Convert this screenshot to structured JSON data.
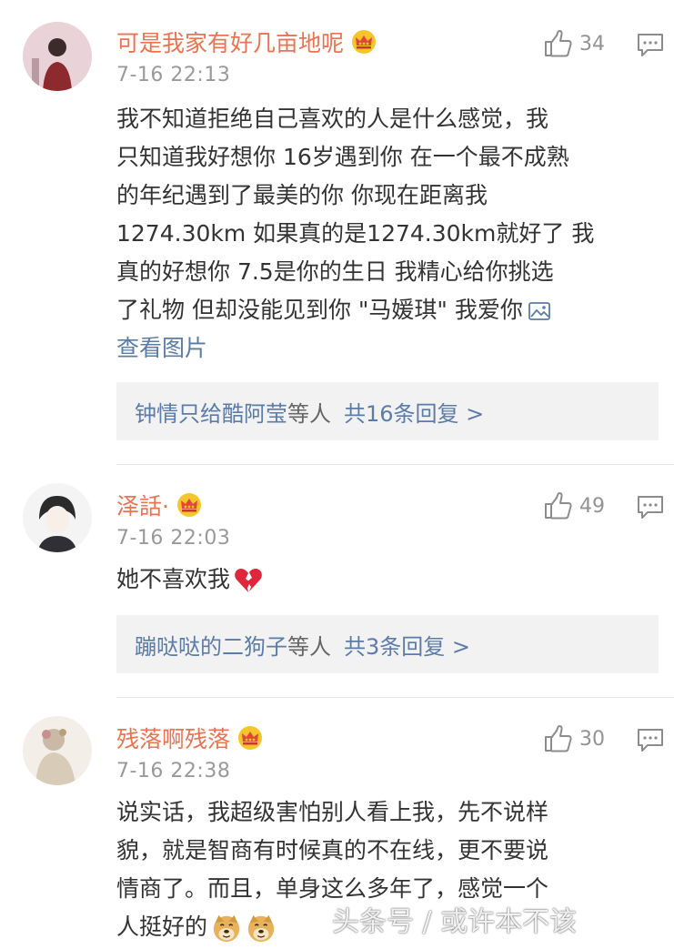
{
  "comments": [
    {
      "username": "可是我家有好几亩地呢",
      "time": "7-16 22:13",
      "likes": "34",
      "lines": [
        "我不知道拒绝自己喜欢的人是什么感觉，我",
        "只知道我好想你 16岁遇到你 在一个最不成熟",
        "的年纪遇到了最美的你 你现在距离我",
        "1274.30km 如果真的是1274.30km就好了 我",
        "真的好想你 7.5是你的生日 我精心给你挑选",
        "了礼物 但却没能见到你 \"马媛琪\" 我爱你"
      ],
      "see_image": "查看图片",
      "replies": {
        "names": "钟情只给酷阿莹",
        "mid": "等人",
        "count": "共16条回复 >"
      }
    },
    {
      "username": "泽話·",
      "time": "7-16 22:03",
      "likes": "49",
      "text": "她不喜欢我",
      "replies": {
        "names": "蹦哒哒的二狗子",
        "mid": "等人",
        "count": "共3条回复 >"
      }
    },
    {
      "username": "残落啊残落",
      "time": "7-16 22:38",
      "likes": "30",
      "lines": [
        "说实话，我超级害怕别人看上我，先不说样",
        "貌，就是智商有时候真的不在线，更不要说",
        "情商了。而且，单身这么多年了，感觉一个",
        "人挺好的"
      ]
    }
  ],
  "watermark": "头条号 / 或许本不该",
  "colors": {
    "username": "#eb7350",
    "link": "#5b7ba8",
    "time": "#999999",
    "reply_bg": "#f2f2f2"
  },
  "icons": [
    "thumb-up-icon",
    "reply-icon",
    "crown-icon",
    "image-icon",
    "broken-heart-icon",
    "doge-emoji-icon"
  ]
}
